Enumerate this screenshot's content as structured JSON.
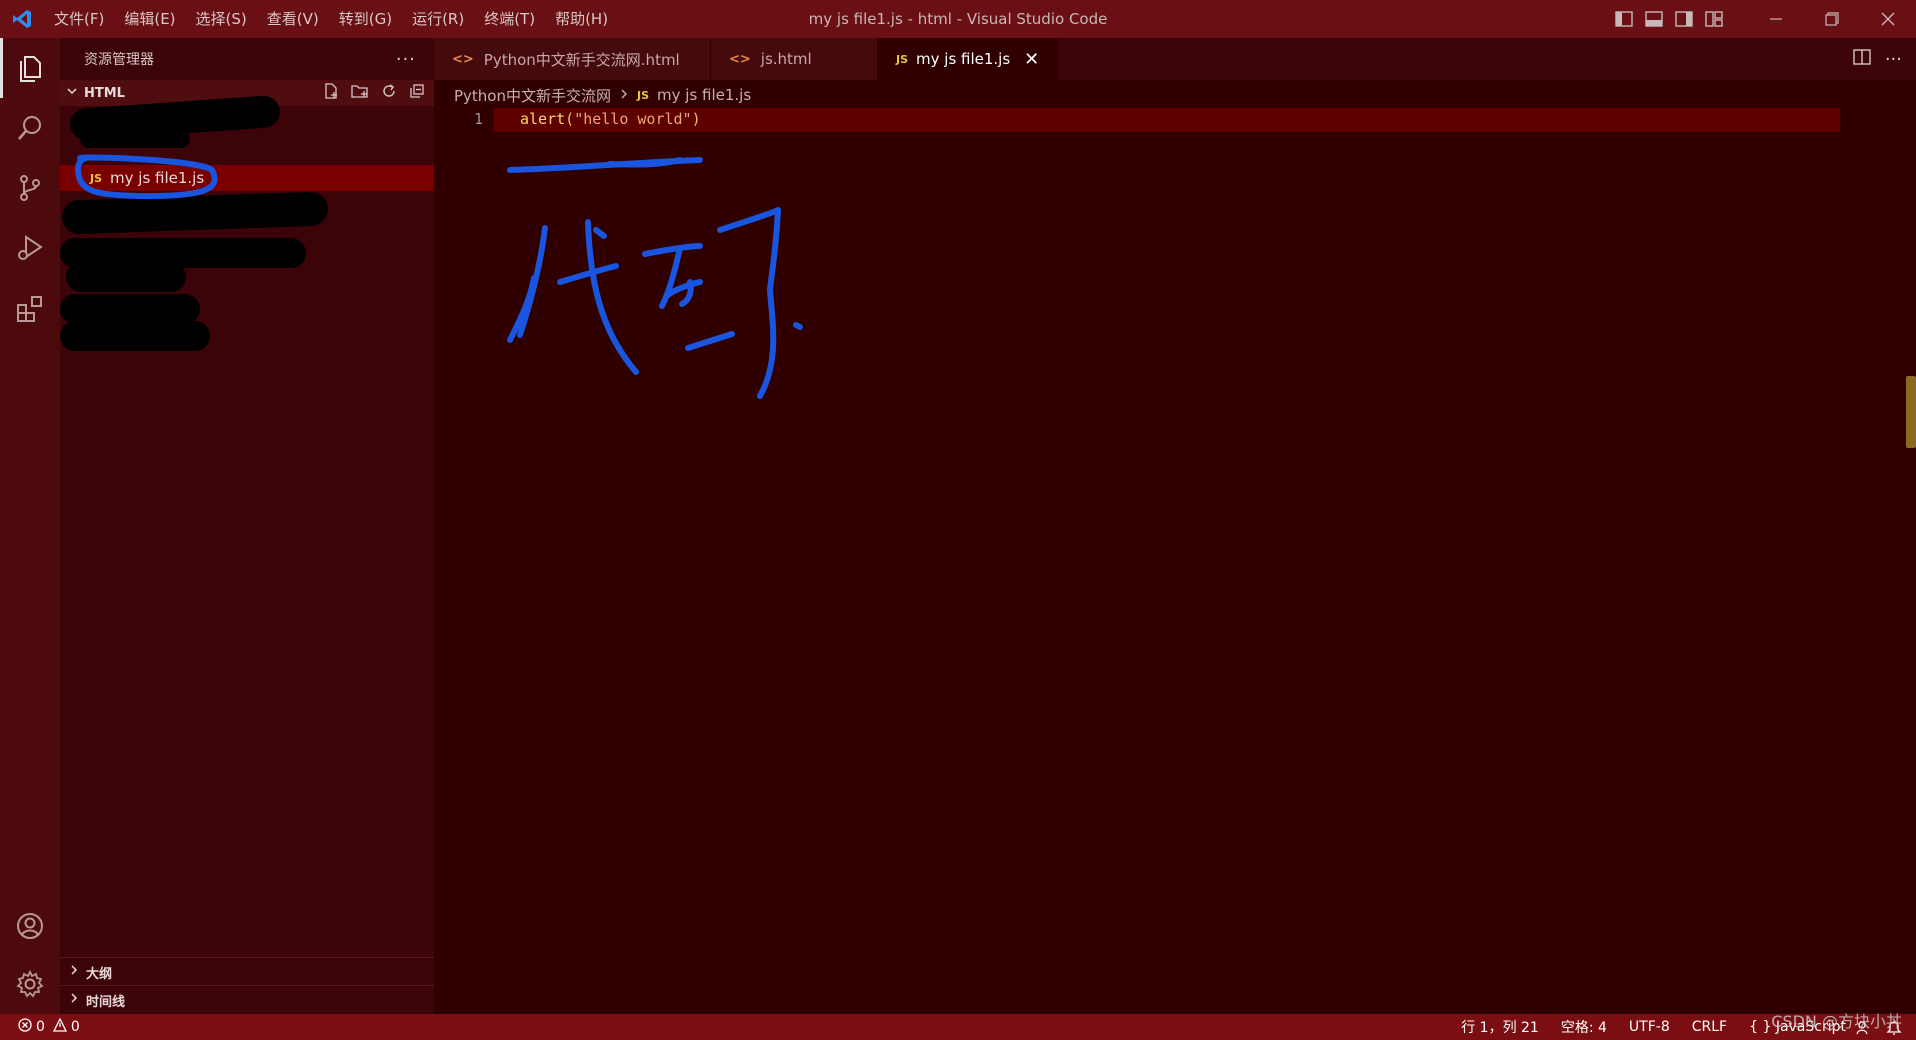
{
  "titlebar": {
    "menu": [
      "文件(F)",
      "编辑(E)",
      "选择(S)",
      "查看(V)",
      "转到(G)",
      "运行(R)",
      "终端(T)",
      "帮助(H)"
    ],
    "window_title": "my js file1.js - html - Visual Studio Code"
  },
  "sidebar": {
    "title": "资源管理器",
    "more": "···",
    "folder": "HTML",
    "selected_file": "my js file1.js",
    "outline": "大纲",
    "timeline": "时间线"
  },
  "tabs": [
    {
      "label": "Python中文新手交流网.html",
      "icon": "html-icon"
    },
    {
      "label": "js.html",
      "icon": "html-icon"
    },
    {
      "label": "my js file1.js",
      "icon": "js-icon"
    }
  ],
  "breadcrumb": {
    "folder": "Python中文新手交流网",
    "file": "my js file1.js"
  },
  "editor": {
    "line_number": "1",
    "code_fn": "alert",
    "code_open": "(",
    "code_str": "\"hello world\"",
    "code_close": ")"
  },
  "annotation": {
    "handwritten_text": "代码",
    "color": "#1a55e0"
  },
  "statusbar": {
    "errors": "0",
    "warnings": "0",
    "position": "行 1，列 21",
    "spaces": "空格: 4",
    "encoding": "UTF-8",
    "eol": "CRLF",
    "language_braces": "{ }",
    "language": "JavaScript"
  },
  "watermark": "CSDN @方块小丼",
  "colors": {
    "titlebar": "#6a0f14",
    "activitybar": "#4c0a0d",
    "sidebar": "#3c0408",
    "editor": "#300000",
    "statusbar": "#7a0e12",
    "selection": "#7a0000"
  }
}
